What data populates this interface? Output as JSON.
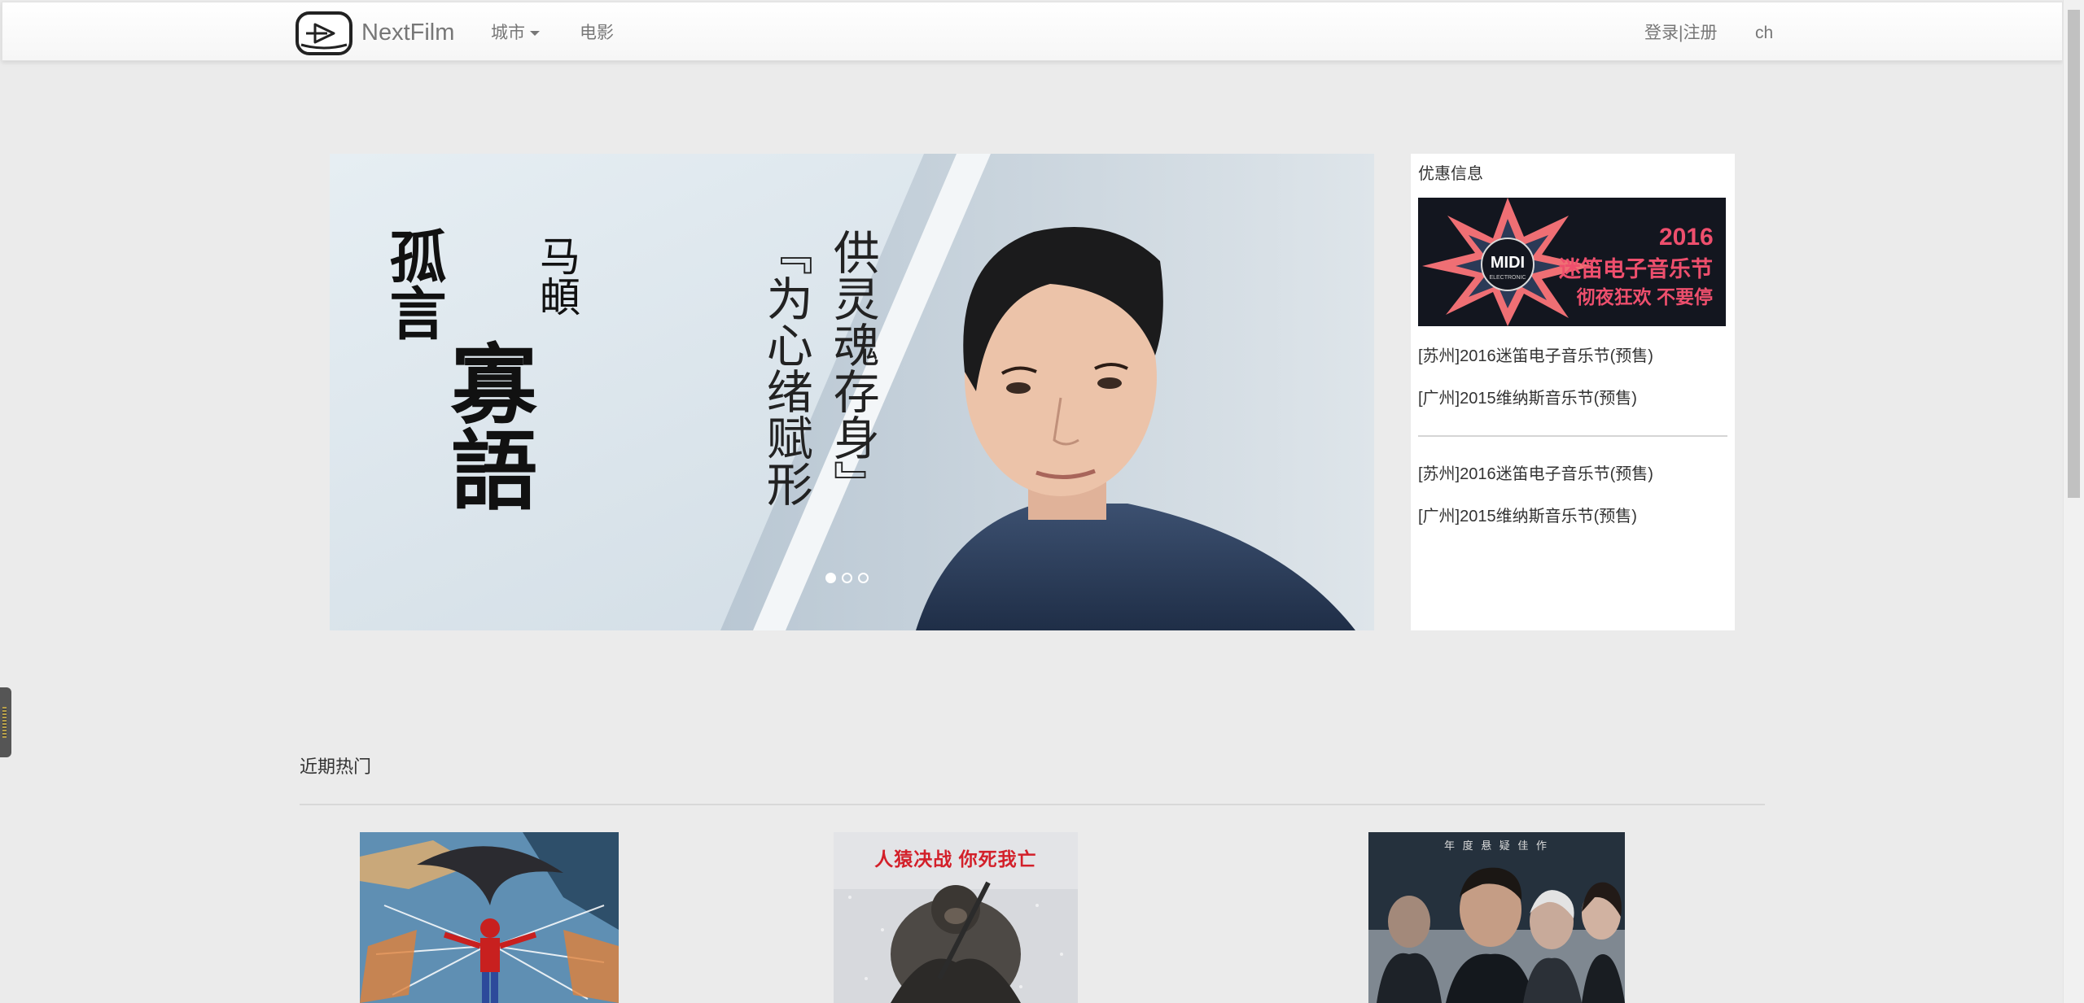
{
  "navbar": {
    "brand": "NextFilm",
    "city_label": "城市",
    "movie_label": "电影",
    "login_label": "登录|注册",
    "lang_label": "ch"
  },
  "carousel": {
    "title_col1": "孤言",
    "title_col2": "寡語",
    "subtitle": "马頔",
    "quote_col1": "『为心绪赋形",
    "quote_col2": "供灵魂存身』",
    "slide_count": 3,
    "active_slide": 1
  },
  "promo": {
    "title": "优惠信息",
    "banner": {
      "brand": "MIDI",
      "brand_sub": "ELECTRONIC",
      "year": "2016",
      "line1": "迷笛电子音乐节",
      "line2": "彻夜狂欢 不要停"
    },
    "items": [
      "[苏州]2016迷笛电子音乐节(预售)",
      "[广州]2015维纳斯音乐节(预售)",
      "[苏州]2016迷笛电子音乐节(预售)",
      "[广州]2015维纳斯音乐节(预售)"
    ]
  },
  "hot": {
    "title": "近期热门",
    "posters": [
      {
        "name": "poster-spiderman"
      },
      {
        "name": "poster-apes",
        "caption": "人猿决战 你死我亡"
      },
      {
        "name": "poster-thriller",
        "caption": "年 度 悬 疑 佳 作"
      }
    ]
  },
  "colors": {
    "page_bg": "#ebebeb",
    "nav_text": "#777777",
    "promo_accent": "#ee4f6d",
    "apes_caption": "#d3202a"
  },
  "icons": [
    "logo-film-icon",
    "caret-down-icon"
  ]
}
